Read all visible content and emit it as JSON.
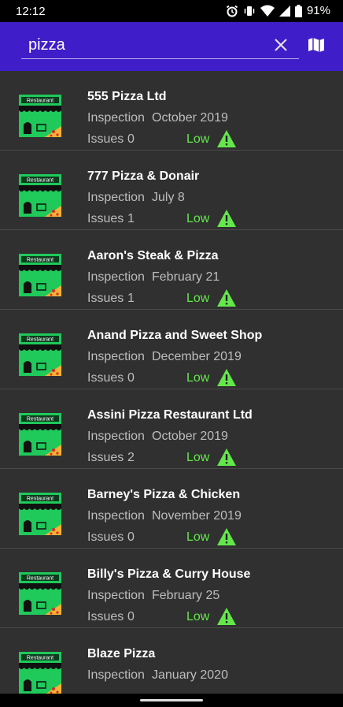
{
  "status_bar": {
    "time": "12:12",
    "battery": "91%"
  },
  "search": {
    "query": "pizza"
  },
  "colors": {
    "app_bar": "#3f1ec9",
    "low_hazard": "#63e84a",
    "background": "#303030"
  },
  "icons": {
    "clear": "close-icon",
    "map": "map-icon",
    "thumbnail": "restaurant-storefront-icon",
    "warning": "warning-triangle-icon"
  },
  "thumb_sign_text": "Restaurant",
  "labels": {
    "inspection": "Inspection",
    "issues": "Issues"
  },
  "restaurants": [
    {
      "name": "555 Pizza Ltd",
      "inspection": "October 2019",
      "issues": "0",
      "hazard": "Low"
    },
    {
      "name": "777 Pizza & Donair",
      "inspection": "July 8",
      "issues": "1",
      "hazard": "Low"
    },
    {
      "name": "Aaron's Steak & Pizza",
      "inspection": "February 21",
      "issues": "1",
      "hazard": "Low"
    },
    {
      "name": "Anand Pizza and Sweet Shop",
      "inspection": "December 2019",
      "issues": "0",
      "hazard": "Low"
    },
    {
      "name": "Assini Pizza Restaurant Ltd",
      "inspection": "October 2019",
      "issues": "2",
      "hazard": "Low"
    },
    {
      "name": "Barney's Pizza & Chicken",
      "inspection": "November 2019",
      "issues": "0",
      "hazard": "Low"
    },
    {
      "name": "Billy's Pizza & Curry House",
      "inspection": "February 25",
      "issues": "0",
      "hazard": "Low"
    },
    {
      "name": "Blaze Pizza",
      "inspection": "January 2020",
      "issues": "",
      "hazard": ""
    }
  ]
}
